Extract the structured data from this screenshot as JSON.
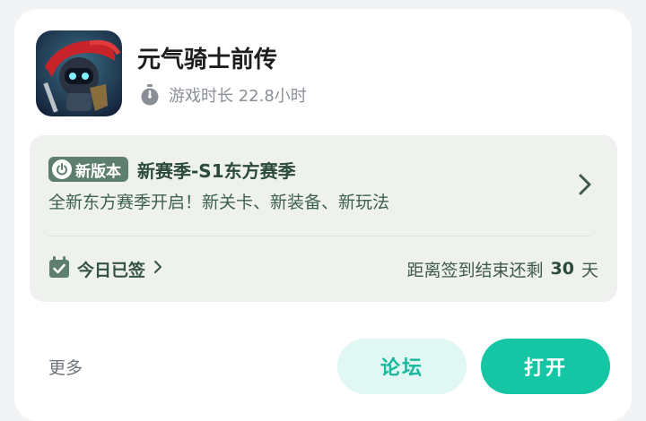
{
  "game": {
    "title": "元气骑士前传",
    "icon": "game-app-icon",
    "playtime_label": "游戏时长 22.8小时"
  },
  "update": {
    "badge_label": "新版本",
    "title": "新赛季-S1东方赛季",
    "description": "全新东方赛季开启！新关卡、新装备、新玩法"
  },
  "signin": {
    "label": "今日已签",
    "countdown_prefix": "距离签到结束还剩",
    "countdown_days": "30",
    "countdown_suffix": "天"
  },
  "footer": {
    "more_label": "更多",
    "forum_label": "论坛",
    "open_label": "打开"
  },
  "colors": {
    "accent": "#14c6a4",
    "forum_bg": "#e0f7f4",
    "panel_bg": "#eef1ee",
    "badge_bg": "#5f7f6e"
  }
}
